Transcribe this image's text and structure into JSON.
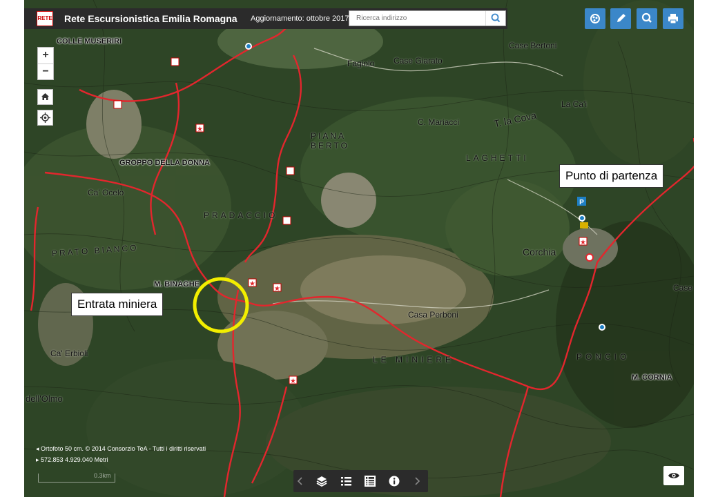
{
  "header": {
    "title": "Rete Escursionistica Emilia Romagna",
    "logo_text": "RETE",
    "update_text": "Aggiornamento: ottobre 2017",
    "search_placeholder": "Ricerca indirizzo"
  },
  "toolbar": {
    "icons": [
      "layers-icon",
      "pencil-icon",
      "search-icon",
      "print-icon"
    ]
  },
  "map_controls": {
    "zoom_in": "+",
    "zoom_out": "−"
  },
  "footer": {
    "attribution": "Ortofoto 50 cm. © 2014 Consorzio TeA - Tutti i diritti riservati",
    "coordinates": "572.853 4.929.040 Metri",
    "scale_label": "0.3km"
  },
  "callouts": {
    "start_point": "Punto di partenza",
    "mine_entrance": "Entrata miniera"
  },
  "place_labels": {
    "colle_museriri": "COLLE MUSERIRI",
    "groppo_della_donna": "GROPPO DELLA DONNA",
    "m_binaghe": "M. BINAGHE",
    "m_cornia": "M. CORNIA",
    "corchia": "Corchia",
    "case_perboni": "Casa Perboni",
    "case_bertoni": "Case Bertoni",
    "case_giarato": "Case Giarato",
    "fagiolo": "Fagiolo",
    "c_mariacci": "C. Mariacci",
    "t_la_cova": "T. la Cova",
    "la_ca": "La Ca'i",
    "ca_ocelo": "Ca' Ocelo",
    "ca_erbioli": "Ca' Erbioli",
    "dell_olmo": "dell'Olmo",
    "prato_bianco": "PRATO BIANCO",
    "pradaccio": "PRADACCIO",
    "le_miniere": "LE MINIERE",
    "laghetti": "LAGHETTI",
    "piana_berto": "PIANA BERTO",
    "poncio": "PONCIO",
    "case": "Case"
  },
  "colors": {
    "trail": "#e3262d",
    "accent": "#3b87c9",
    "highlight": "#f2ee00",
    "bar": "#2b2b2b"
  }
}
